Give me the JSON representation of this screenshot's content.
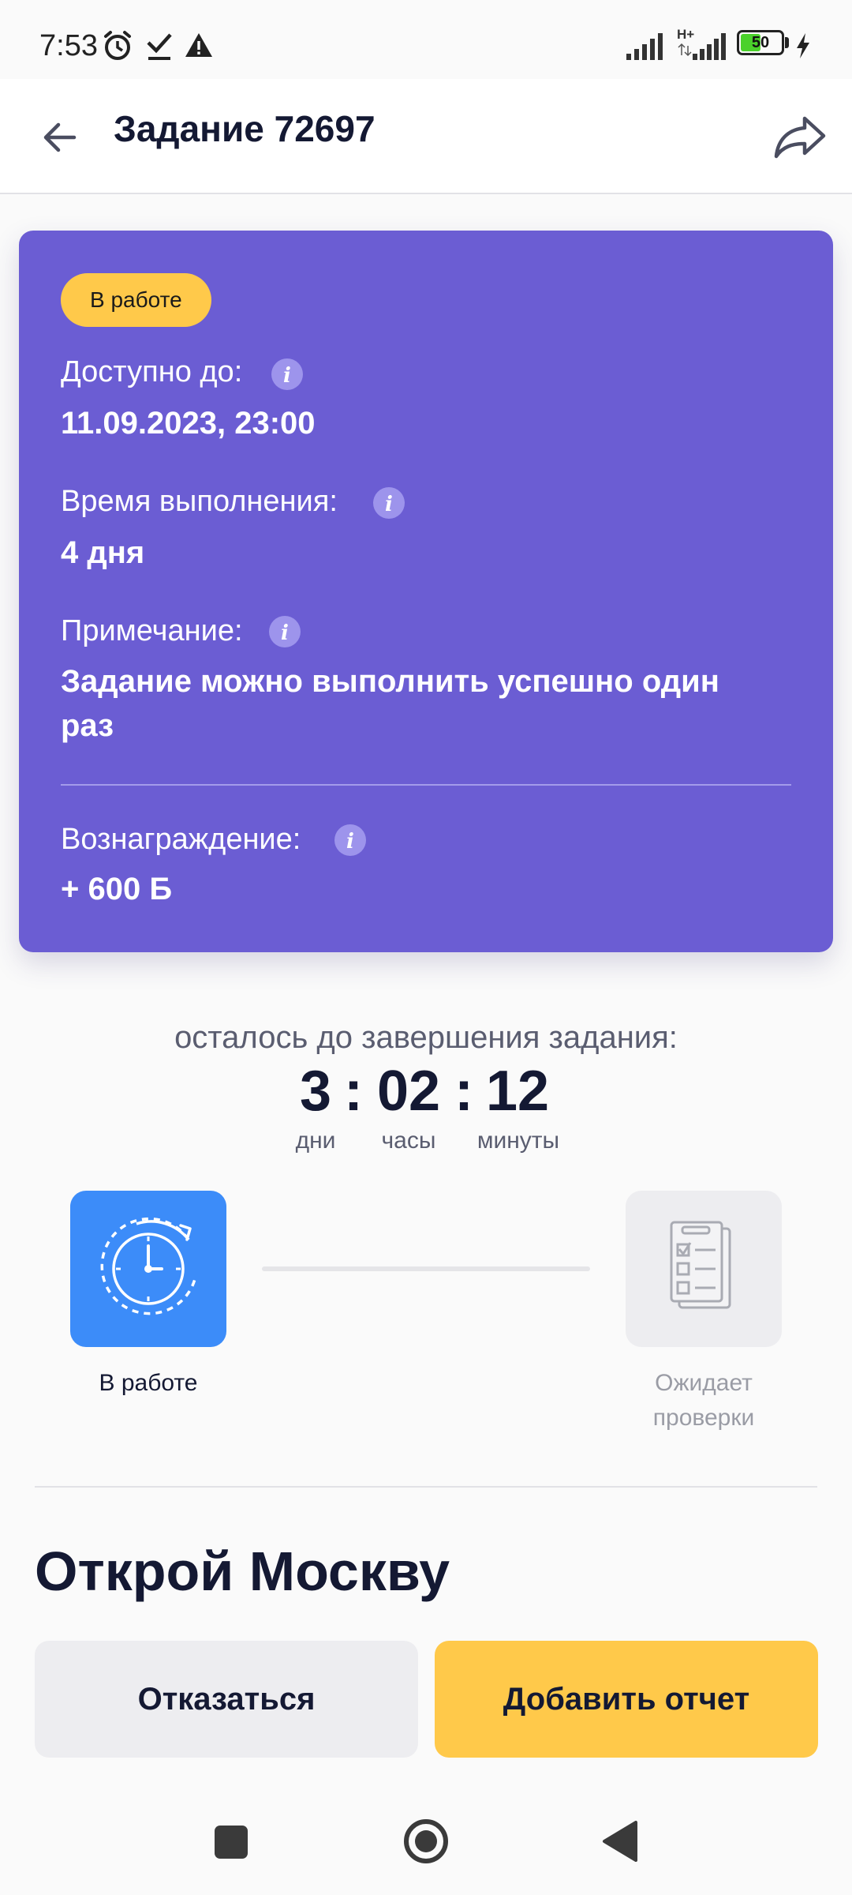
{
  "status_bar": {
    "time": "7:53",
    "network": "H+",
    "battery": "50",
    "battery_level": 0.5,
    "icons": [
      "alarm-icon",
      "check-icon",
      "warning-icon",
      "signal-icon",
      "charging-icon"
    ]
  },
  "header": {
    "title": "Задание 72697",
    "icons": [
      "back-arrow-icon",
      "share-icon"
    ]
  },
  "card": {
    "badge": "В работе",
    "available_label": "Доступно до:",
    "available_value": "11.09.2023, 23:00",
    "duration_label": "Время выполнения:",
    "duration_value": "4 дня",
    "note_label": "Примечание:",
    "note_line1": "Задание можно выполнить успешно один",
    "note_line2": "раз",
    "reward_label": "Вознаграждение:",
    "reward_value": "+ 600 Б"
  },
  "countdown": {
    "caption": "осталось до завершения задания:",
    "days": "3",
    "hours": "02",
    "minutes": "12",
    "separator": ":",
    "days_label": "дни",
    "hours_label": "часы",
    "minutes_label": "минуты"
  },
  "stepper": {
    "step1_label": "В работе",
    "step2_label_line1": "Ожидает",
    "step2_label_line2": "проверки",
    "icons": [
      "clock-refresh-icon",
      "checklist-icon"
    ]
  },
  "section_title": "Открой Москву",
  "buttons": {
    "decline": "Отказаться",
    "add_report": "Добавить отчет"
  },
  "nav_bar": {
    "icons": [
      "recents-square-icon",
      "home-circle-icon",
      "back-triangle-icon"
    ]
  },
  "colors": {
    "card": "#6b5dd3",
    "badge": "#ffc94a",
    "primary_button": "#ffc94a",
    "step_active": "#3c8cf9",
    "step_inactive": "#ededf0",
    "text_dark": "#141933"
  }
}
